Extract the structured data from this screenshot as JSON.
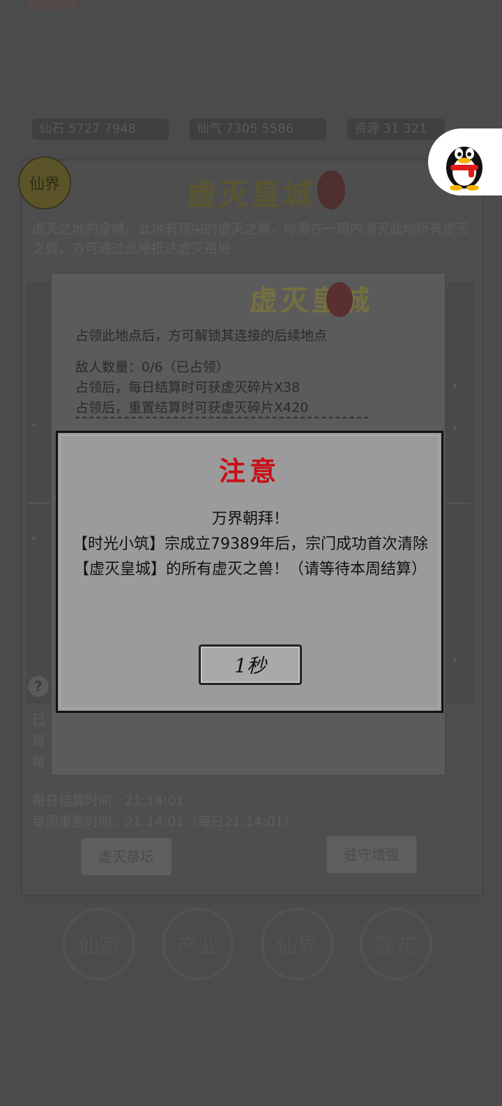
{
  "background": {
    "resources": [
      "仙石 5727 7948",
      "仙气 7305 5586",
      "资源 31 321"
    ],
    "logo_text": "仙界",
    "title": "虚灭皇城",
    "description": "虚灭之地的皇城，此地有顶尖的虚灭之兽，你需在一周内消灭此地所有虚灭之兽，方可通过此地抵达虚灭祖地",
    "daily_settle": "每日结算时间：21:14:01",
    "weekly_reset": "每周重置时间：21:14:01（每日21:14:01）",
    "btn_altar": "虚灭祭坛",
    "btn_guard": "驻守增强",
    "nav": [
      "仙宗",
      "产业",
      "仙界",
      "莲花"
    ],
    "partial_left": [
      "已",
      "每",
      "每"
    ]
  },
  "location_dialog": {
    "title": "虚灭皇城",
    "unlock_hint": "占领此地点后，方可解锁其连接的后续地点",
    "enemy_count": "敌人数量：0/6（已占领）",
    "daily_reward": "占领后，每日结算时可获虚灭碎片X38",
    "reset_reward": "占领后，重置结算时可获虚灭碎片X420"
  },
  "notice": {
    "title": "注意",
    "line1": "万界朝拜！",
    "line2": "【时光小筑】宗成立79389年后，宗门成功首次清除【虚灭皇城】的所有虚灭之兽！（请等待本周结算）",
    "button": "1秒"
  },
  "colors": {
    "notice_title": "#c81018",
    "overlay_bg": "#4b4b4b",
    "notice_bg": "#9b9b9b"
  },
  "icons": {
    "floating": "qq-penguin-icon",
    "help": "question-icon"
  }
}
